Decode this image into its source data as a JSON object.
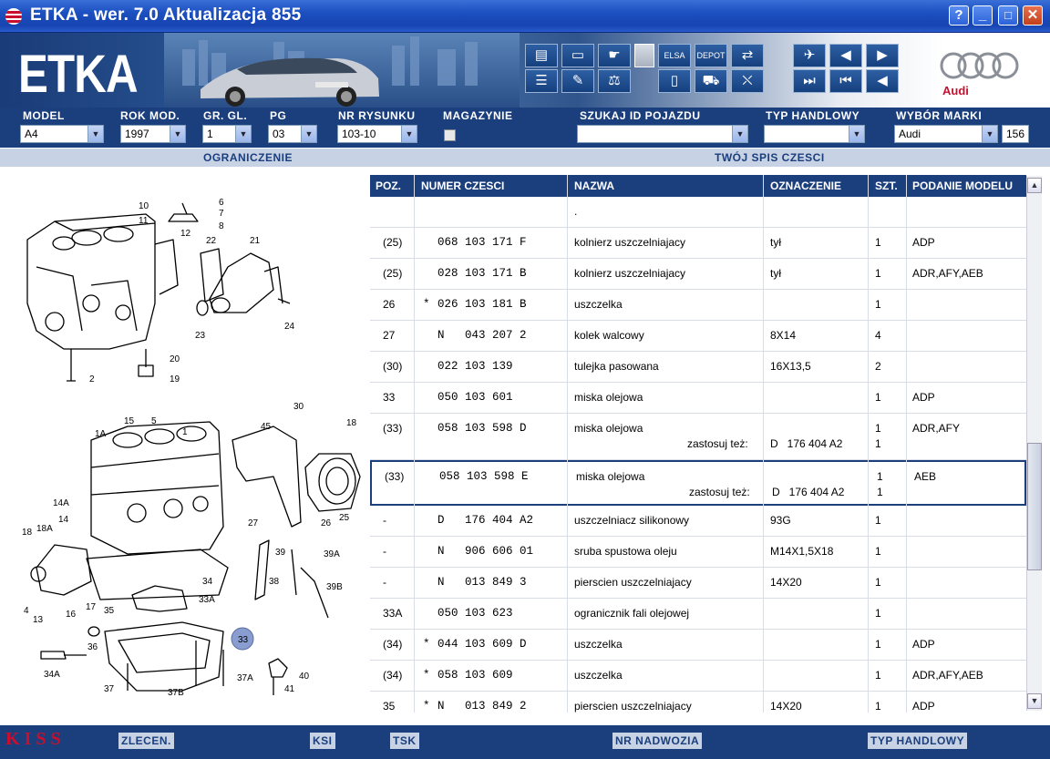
{
  "window": {
    "title": "ETKA - wer. 7.0 Aktualizacja 855",
    "buttons": [
      "?",
      "_",
      "□",
      "✕"
    ]
  },
  "header": {
    "logo": "ETKA",
    "brand": "Audi"
  },
  "selectors": {
    "model": {
      "label": "MODEL",
      "value": "A4"
    },
    "rok": {
      "label": "ROK MOD.",
      "value": "1997"
    },
    "gr": {
      "label": "GR. GL.",
      "value": "1"
    },
    "pg": {
      "label": "PG",
      "value": "03"
    },
    "nr": {
      "label": "NR RYSUNKU",
      "value": "103-10"
    },
    "mag": {
      "label": "MAGAZYNIE"
    },
    "szukaj": {
      "label": "SZUKAJ ID POJAZDU",
      "value": ""
    },
    "typ": {
      "label": "TYP HANDLOWY",
      "value": ""
    },
    "marka": {
      "label": "WYBÓR MARKI",
      "value": "Audi"
    },
    "counter": "156"
  },
  "sections": {
    "left": "OGRANICZENIE",
    "right": "TWÓJ SPIS CZESCI"
  },
  "table": {
    "headers": [
      "POZ.",
      "NUMER CZESCI",
      "NAZWA",
      "OZNACZENIE",
      "SZT.",
      "PODANIE MODELU"
    ],
    "rows": [
      {
        "poz": "",
        "star": "",
        "num": "",
        "name": ".",
        "ozn": "",
        "szt": "",
        "model": ""
      },
      {
        "poz": "(25)",
        "star": "",
        "num": "068 103 171 F",
        "name": "kolnierz uszczelniajacy",
        "ozn": "tył",
        "szt": "1",
        "model": "ADP"
      },
      {
        "poz": "(25)",
        "star": "",
        "num": "028 103 171 B",
        "name": "kolnierz uszczelniajacy",
        "ozn": "tył",
        "szt": "1",
        "model": "ADR,AFY,AEB"
      },
      {
        "poz": "26",
        "star": "*",
        "num": "026 103 181 B",
        "name": "uszczelka",
        "ozn": "",
        "szt": "1",
        "model": ""
      },
      {
        "poz": "27",
        "star": "",
        "num": "N   043 207 2",
        "name": "kolek walcowy",
        "ozn": "8X14",
        "szt": "4",
        "model": ""
      },
      {
        "poz": "(30)",
        "star": "",
        "num": "022 103 139",
        "name": "tulejka pasowana",
        "ozn": "16X13,5",
        "szt": "2",
        "model": ""
      },
      {
        "poz": "33",
        "star": "",
        "num": "050 103 601",
        "name": "miska olejowa",
        "ozn": "",
        "szt": "1",
        "model": "ADP"
      },
      {
        "poz": "(33)",
        "star": "",
        "num": "058 103 598 D",
        "name": "miska olejowa",
        "ozn": "",
        "szt": "1",
        "model": "ADR,AFY",
        "extra_label": "zastosuj też:",
        "extra_ozn": "D   176 404 A2",
        "extra_szt": "1"
      },
      {
        "poz": "(33)",
        "star": "",
        "num": "058 103 598 E",
        "name": "miska olejowa",
        "ozn": "",
        "szt": "1",
        "model": "AEB",
        "extra_label": "zastosuj też:",
        "extra_ozn": "D   176 404 A2",
        "extra_szt": "1"
      },
      {
        "poz": "-",
        "star": "",
        "num": "D   176 404 A2",
        "name": "uszczelniacz silikonowy",
        "ozn": "93G",
        "szt": "1",
        "model": ""
      },
      {
        "poz": "-",
        "star": "",
        "num": "N   906 606 01",
        "name": "sruba spustowa oleju",
        "ozn": "M14X1,5X18",
        "szt": "1",
        "model": ""
      },
      {
        "poz": "-",
        "star": "",
        "num": "N   013 849 3",
        "name": "pierscien uszczelniajacy",
        "ozn": "14X20",
        "szt": "1",
        "model": ""
      },
      {
        "poz": "33A",
        "star": "",
        "num": "050 103 623",
        "name": "ogranicznik fali olejowej",
        "ozn": "",
        "szt": "1",
        "model": ""
      },
      {
        "poz": "(34)",
        "star": "*",
        "num": "044 103 609 D",
        "name": "uszczelka",
        "ozn": "",
        "szt": "1",
        "model": "ADP"
      },
      {
        "poz": "(34)",
        "star": "*",
        "num": "058 103 609",
        "name": "uszczelka",
        "ozn": "",
        "szt": "1",
        "model": "ADR,AFY,AEB"
      },
      {
        "poz": "35",
        "star": "*",
        "num": "N   013 849 2",
        "name": "pierscien uszczelniajacy",
        "ozn": "14X20",
        "szt": "1",
        "model": "ADP"
      }
    ]
  },
  "diagram": {
    "labels_top": [
      "6",
      "7",
      "8",
      "10",
      "11",
      "12",
      "22",
      "21",
      "23",
      "24",
      "20",
      "19",
      "2"
    ],
    "labels_bottom": [
      "30",
      "18",
      "1A",
      "15",
      "5",
      "1",
      "45",
      "14A",
      "14",
      "27",
      "26",
      "25",
      "18",
      "18A",
      "39",
      "39A",
      "34",
      "38",
      "39B",
      "33A",
      "4",
      "13",
      "16",
      "17",
      "35",
      "36",
      "33",
      "34A",
      "37",
      "37B",
      "37A",
      "40",
      "41"
    ]
  },
  "statusbar": {
    "kiss": "KISS",
    "items": [
      "ZLECEN.",
      "KSI",
      "TSK",
      "NR NADWOZIA",
      "TYP HANDLOWY"
    ]
  }
}
